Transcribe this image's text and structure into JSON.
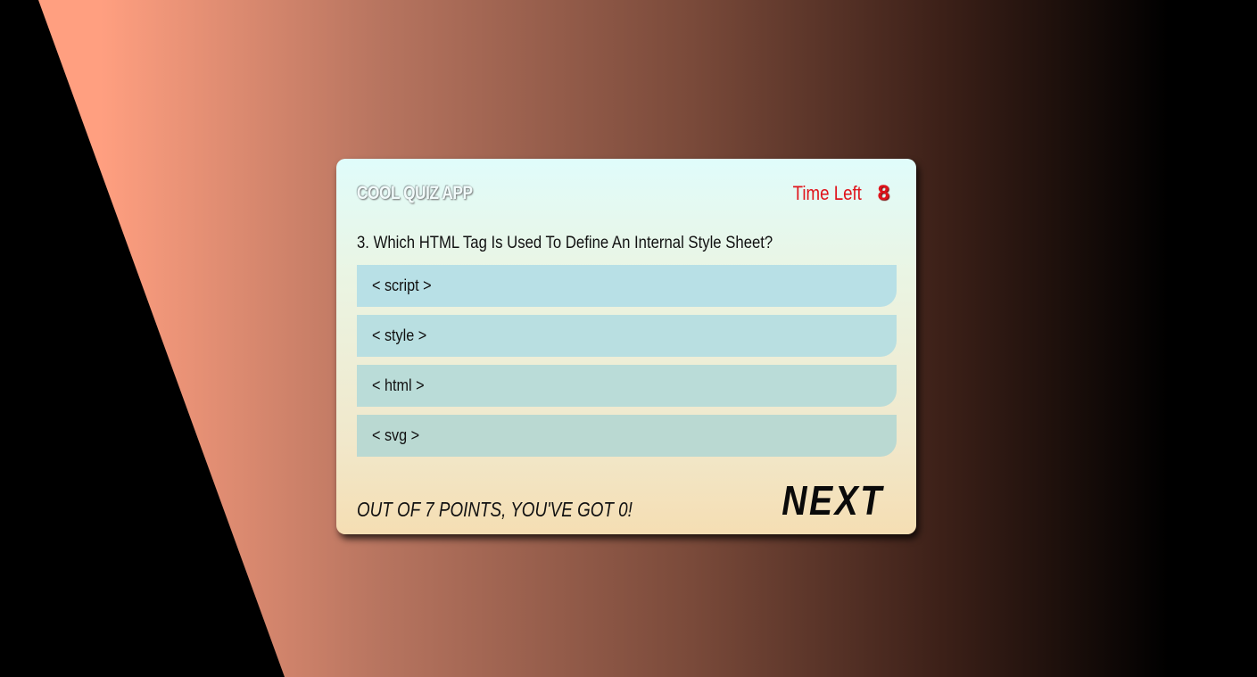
{
  "header": {
    "app_title": "COOL QUIZ APP",
    "timer_label": "Time Left",
    "timer_value": "8"
  },
  "question": {
    "text": "3. Which HTML Tag Is Used To Define An Internal Style Sheet?",
    "options": [
      {
        "label": "< script >"
      },
      {
        "label": "< style >"
      },
      {
        "label": "< html >"
      },
      {
        "label": "< svg >"
      }
    ]
  },
  "footer": {
    "score_text": "OUT OF 7 POINTS, YOU'VE GOT 0!",
    "next_label": "NEXT"
  },
  "colors": {
    "timer": "#e0141b",
    "option_bg": "#b8e0e6",
    "accent_background": "#ff9f80"
  }
}
